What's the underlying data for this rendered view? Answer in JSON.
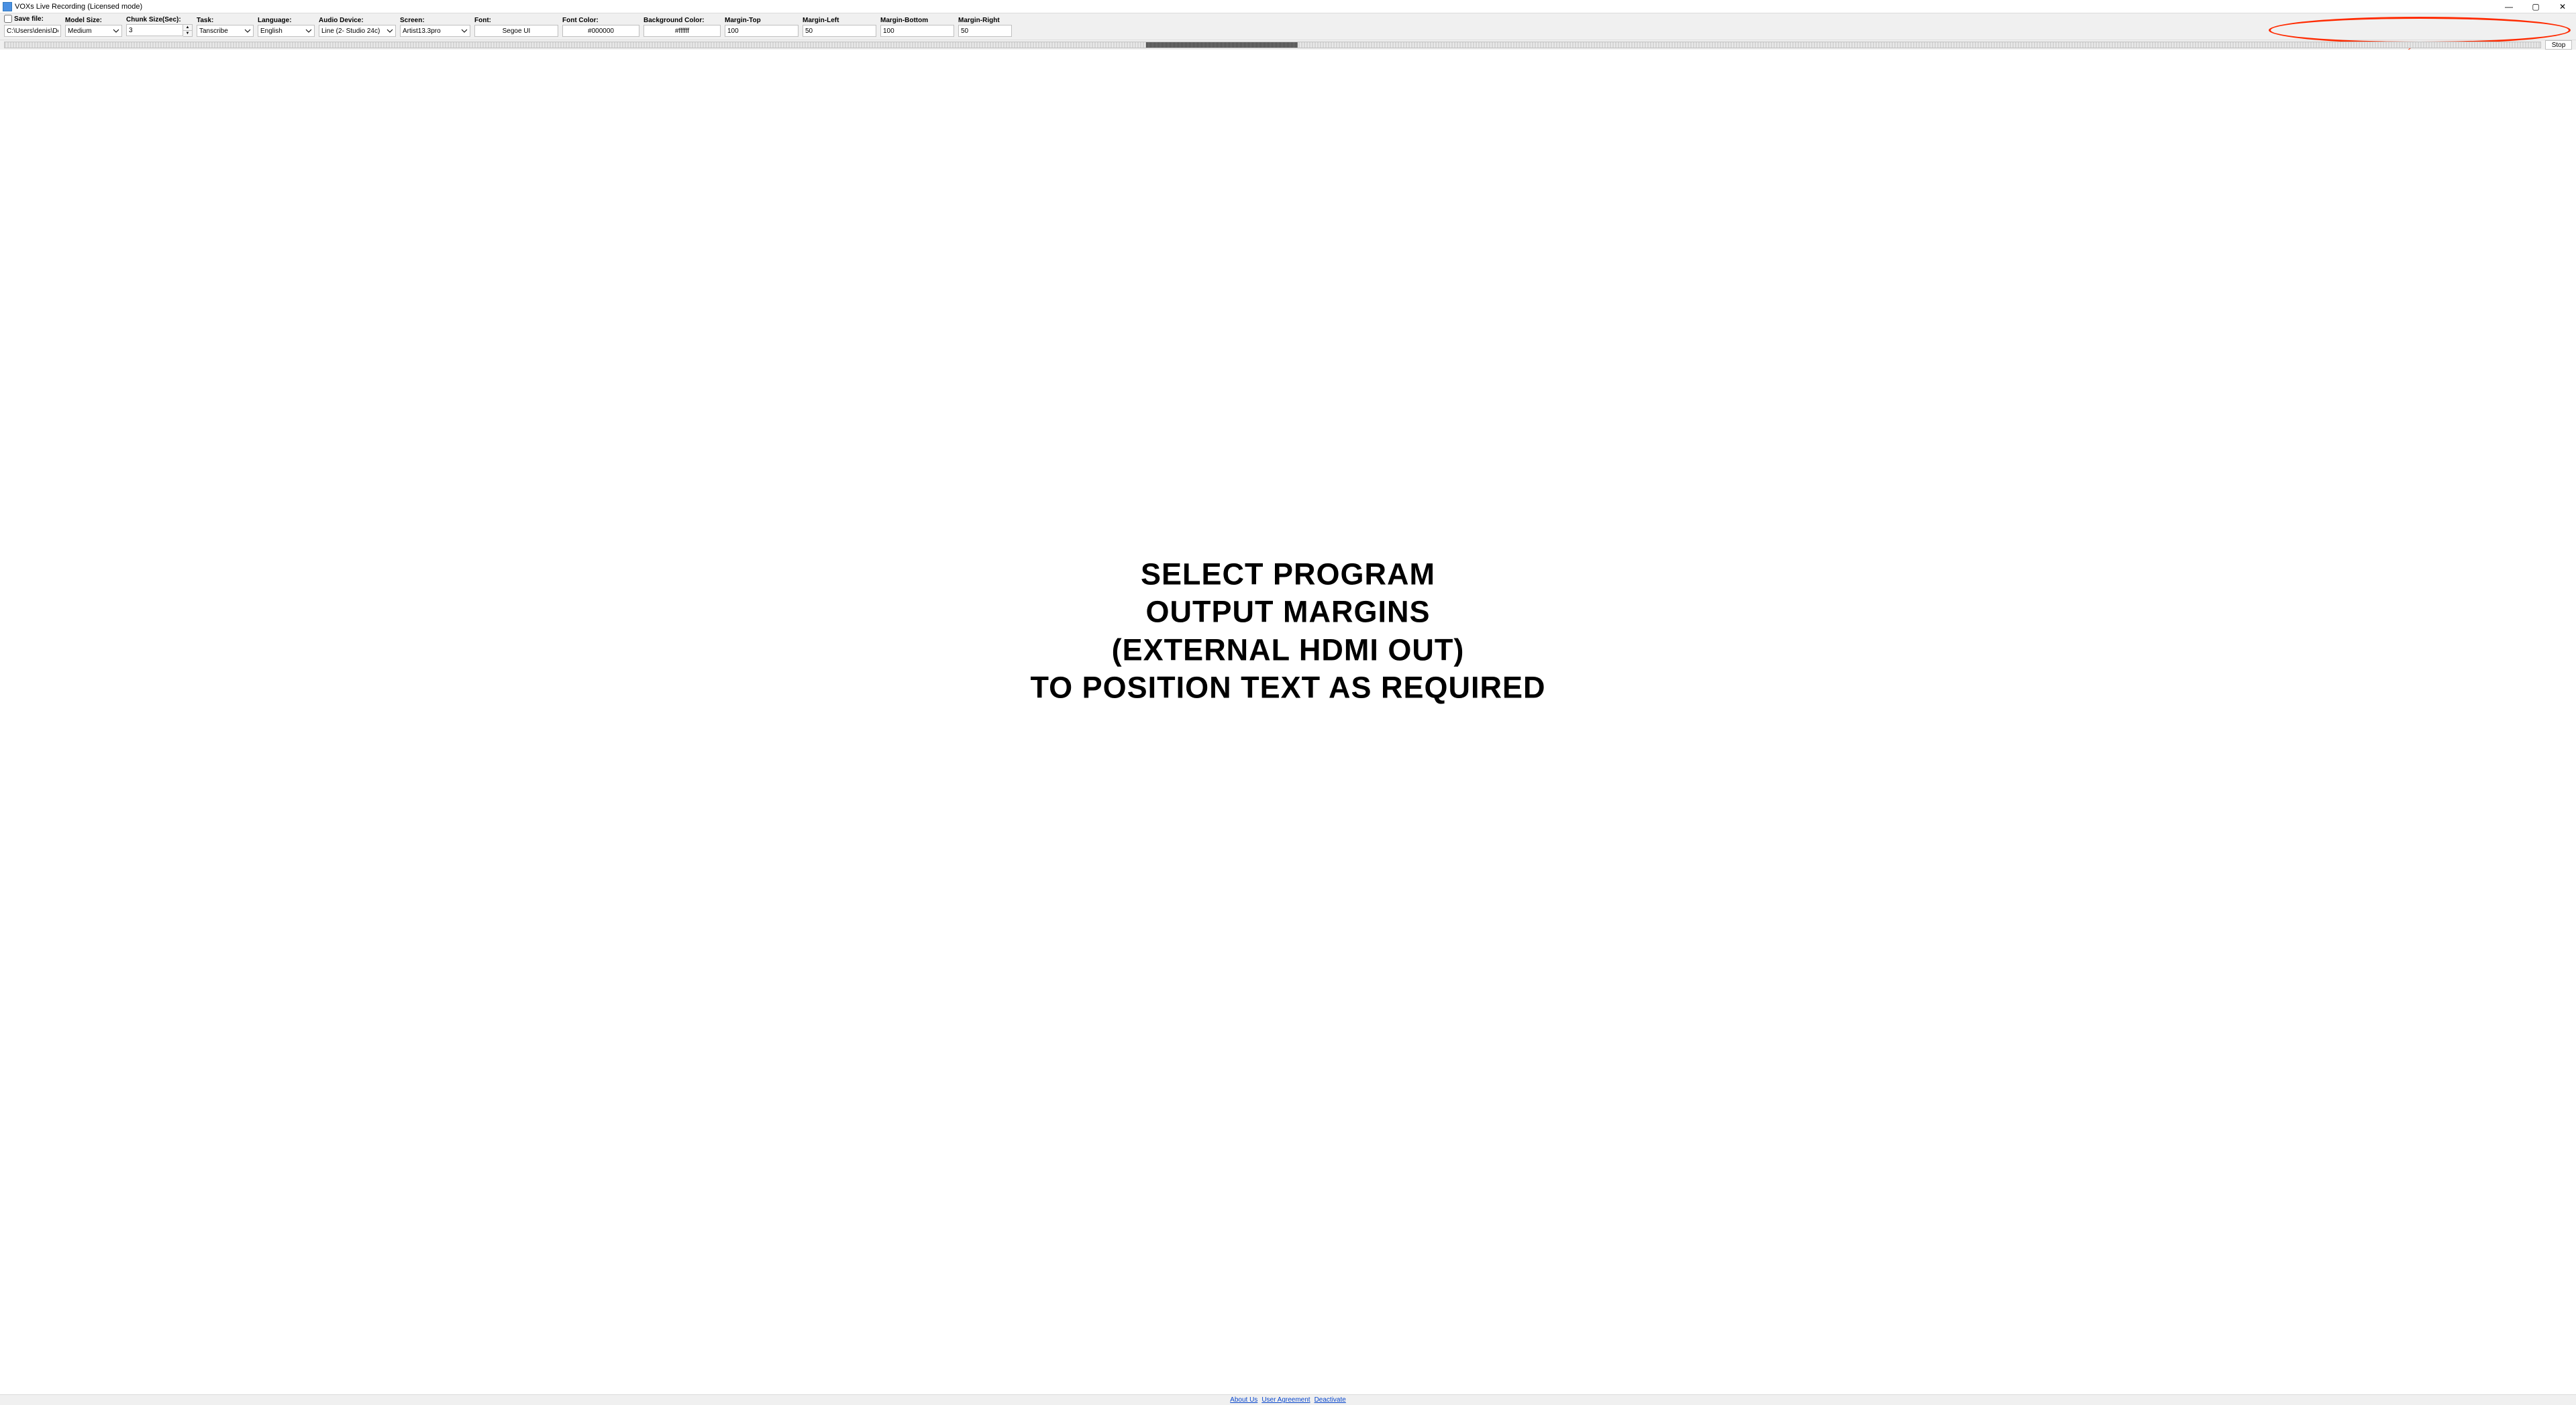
{
  "title": "VOXs Live Recording (Licensed mode)",
  "window_controls": {
    "minimize": "—",
    "maximize": "▢",
    "close": "✕"
  },
  "labels": {
    "save_file": "Save file:",
    "model_size": "Model Size:",
    "chunk_size": "Chunk Size(Sec):",
    "task": "Task:",
    "language": "Language:",
    "audio_device": "Audio Device:",
    "screen": "Screen:",
    "font": "Font:",
    "font_color": "Font Color:",
    "background_color": "Background Color:",
    "margin_top": "Margin-Top",
    "margin_left": "Margin-Left",
    "margin_bottom": "Margin-Bottom",
    "margin_right": "Margin-Right"
  },
  "values": {
    "save_file": "C:\\Users\\denis\\Desktop",
    "model_size": "Medium",
    "chunk_size": "3",
    "task": "Tanscribe",
    "language": "English",
    "audio_device": "Line (2- Studio 24c)",
    "screen": "Artist13.3pro",
    "font": "Segoe UI",
    "font_color": "#000000",
    "background_color": "#ffffff",
    "margin_top": "100",
    "margin_left": "50",
    "margin_bottom": "100",
    "margin_right": "50"
  },
  "stop_label": "Stop",
  "annotation": {
    "line1": "SELECT PROGRAM",
    "line2": "OUTPUT MARGINS",
    "line3": "(EXTERNAL HDMI OUT)",
    "line4": "TO POSITION TEXT AS REQUIRED"
  },
  "footer": {
    "about": "About Us",
    "agreement": "User Agreement",
    "deactivate": "Deactivate"
  }
}
